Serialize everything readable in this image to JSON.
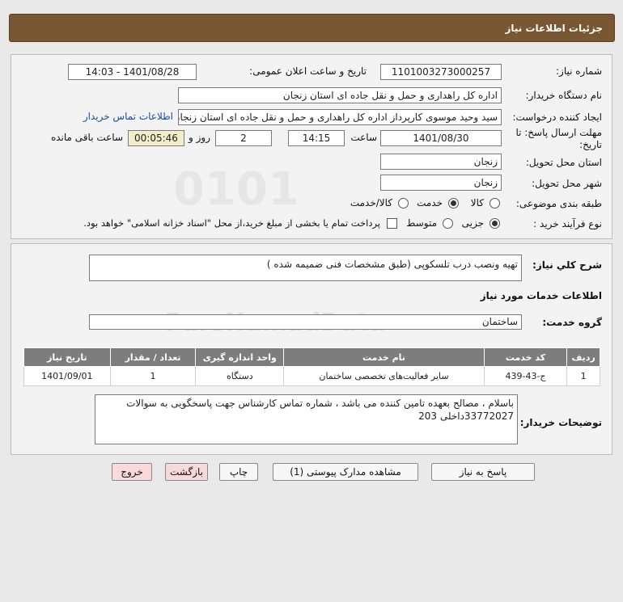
{
  "header": {
    "title": "جزئیات اطلاعات نیاز"
  },
  "form": {
    "need_number_label": "شماره نیاز:",
    "need_number": "1101003273000257",
    "announce_label": "تاریخ و ساعت اعلان عمومی:",
    "announce_value": "1401/08/28 - 14:03",
    "buyer_org_label": "نام دستگاه خریدار:",
    "buyer_org": "اداره کل راهداری و حمل و نقل جاده ای استان زنجان",
    "requester_label": "ایجاد کننده درخواست:",
    "requester": "سید وحید موسوی کارپرداز اداره کل راهداری و حمل و نقل جاده ای استان زنجان",
    "contact_link": "اطلاعات تماس خریدار",
    "deadline_label_1": "مهلت ارسال پاسخ: تا",
    "deadline_label_2": "تاریخ:",
    "deadline_date": "1401/08/30",
    "time_label": "ساعت",
    "deadline_time": "14:15",
    "days_value": "2",
    "days_label": "روز و",
    "remaining_time": "00:05:46",
    "remaining_label": "ساعت باقی مانده",
    "province_label": "استان محل تحویل:",
    "province": "زنجان",
    "city_label": "شهر محل تحویل:",
    "city": "زنجان",
    "category_label": "طبقه بندی موضوعی:",
    "category_options": [
      "کالا",
      "خدمت",
      "کالا/خدمت"
    ],
    "category_selected": "خدمت",
    "process_label": "نوع فرآیند خرید :",
    "process_options": [
      "جزیی",
      "متوسط"
    ],
    "process_selected": "جزیی",
    "payment_note": "پرداخت تمام یا بخشی از مبلغ خرید،از محل \"اسناد خزانه اسلامی\" خواهد بود."
  },
  "details": {
    "summary_label": "شرح کلي نياز:",
    "summary": "تهیه ونصب درب تلسکوپی (طبق مشخصات فنی ضمیمه شده )",
    "services_heading": "اطلاعات خدمات مورد نیاز",
    "service_group_label": "گروه خدمت:",
    "service_group": "ساختمان",
    "table_headers": [
      "ردیف",
      "کد خدمت",
      "نام خدمت",
      "واحد اندازه گیری",
      "تعداد / مقدار",
      "تاریخ نیاز"
    ],
    "table_rows": [
      [
        "1",
        "ج-43-439",
        "سایر فعالیت‌های تخصصی ساختمان",
        "دستگاه",
        "1",
        "1401/09/01"
      ]
    ],
    "buyer_notes_label": "توضیحات خریدار:",
    "buyer_notes": "باسلام ، مصالح بعهده تامین کننده می باشد ، شماره تماس کارشناس جهت پاسخگویی به سوالات 33772027داخلی 203"
  },
  "buttons": {
    "reply": "پاسخ به نیاز",
    "attachments": "مشاهده مدارک پیوستی (1)",
    "print": "چاپ",
    "back": "بازگشت",
    "exit": "خروج"
  }
}
